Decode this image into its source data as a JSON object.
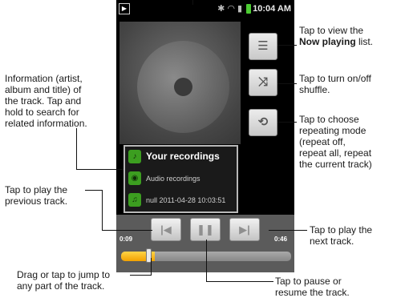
{
  "status_bar": {
    "time": "10:04 AM",
    "icons": [
      "app-icon",
      "bluetooth-icon",
      "wifi-icon",
      "signal-icon",
      "battery-icon"
    ]
  },
  "album_art": {
    "icon": "music-disc-icon"
  },
  "side_buttons": [
    {
      "name": "now-playing-list-button",
      "icon": "list-icon",
      "glyph": "☰"
    },
    {
      "name": "shuffle-button",
      "icon": "shuffle-icon",
      "glyph": "⤨"
    },
    {
      "name": "repeat-button",
      "icon": "repeat-icon",
      "glyph": "⟲"
    }
  ],
  "track_info": {
    "title": "Your recordings",
    "album": "Audio recordings",
    "artist": "null 2011-04-28 10:03:51"
  },
  "controls": {
    "previous_glyph": "|◀",
    "pause_glyph": "❚❚",
    "next_glyph": "▶|"
  },
  "progress": {
    "current_time": "0:09",
    "total_time": "0:46",
    "fraction": 0.196,
    "fill_color": "#f5b21d"
  },
  "annotations": {
    "now_playing_before": "Tap to view the",
    "now_playing_bold": "Now playing",
    "now_playing_after": "list.",
    "shuffle_1": "Tap to turn on/off",
    "shuffle_2": "shuffle.",
    "repeat_1": "Tap to choose",
    "repeat_2": "repeating mode",
    "repeat_3": "(repeat off,",
    "repeat_4": "repeat all, repeat",
    "repeat_5": "the current track)",
    "info_1": "Information (artist,",
    "info_2": "album and title) of",
    "info_3": "the track. Tap and",
    "info_4": "hold to search for",
    "info_5": "related information.",
    "previous_1": "Tap to play the",
    "previous_2": "previous track.",
    "next_1": "Tap to play the",
    "next_2": "next track.",
    "seek_1": "Drag or tap to jump to",
    "seek_2": "any part of the track.",
    "pause_1": "Tap to pause or",
    "pause_2": "resume the track."
  }
}
